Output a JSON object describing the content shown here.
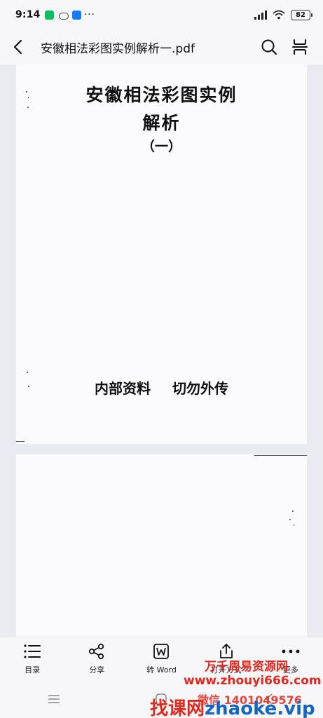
{
  "status_bar": {
    "time": "9:14",
    "more": "···",
    "battery": "82"
  },
  "title_bar": {
    "title": "安徽相法彩图实例解析一.pdf"
  },
  "document": {
    "page1": {
      "title_line1": "安徽相法彩图实例",
      "title_line2": "解析",
      "title_line3": "（一）",
      "footer": "内部资料 切勿外传"
    }
  },
  "bottom_toolbar": {
    "items": [
      {
        "label": "目录",
        "icon": "list-icon"
      },
      {
        "label": "分享",
        "icon": "share-icon"
      },
      {
        "label": "转 Word",
        "icon": "word-icon"
      },
      {
        "label": "打开方式",
        "icon": "open-with-icon"
      },
      {
        "label": "更多",
        "icon": "more-icon"
      }
    ]
  },
  "watermark": {
    "line1": "万千周易资源网",
    "line2": "www.zhouyi666.com",
    "line3": "微信 1401049576",
    "line4_cn": "找课网",
    "line4_en": "zhaoke.vip"
  },
  "colors": {
    "watermark_red": "#e0281e",
    "watermark_blue": "#1565c0",
    "app_wechat": "#07c160",
    "app_blue": "#1677ff"
  }
}
